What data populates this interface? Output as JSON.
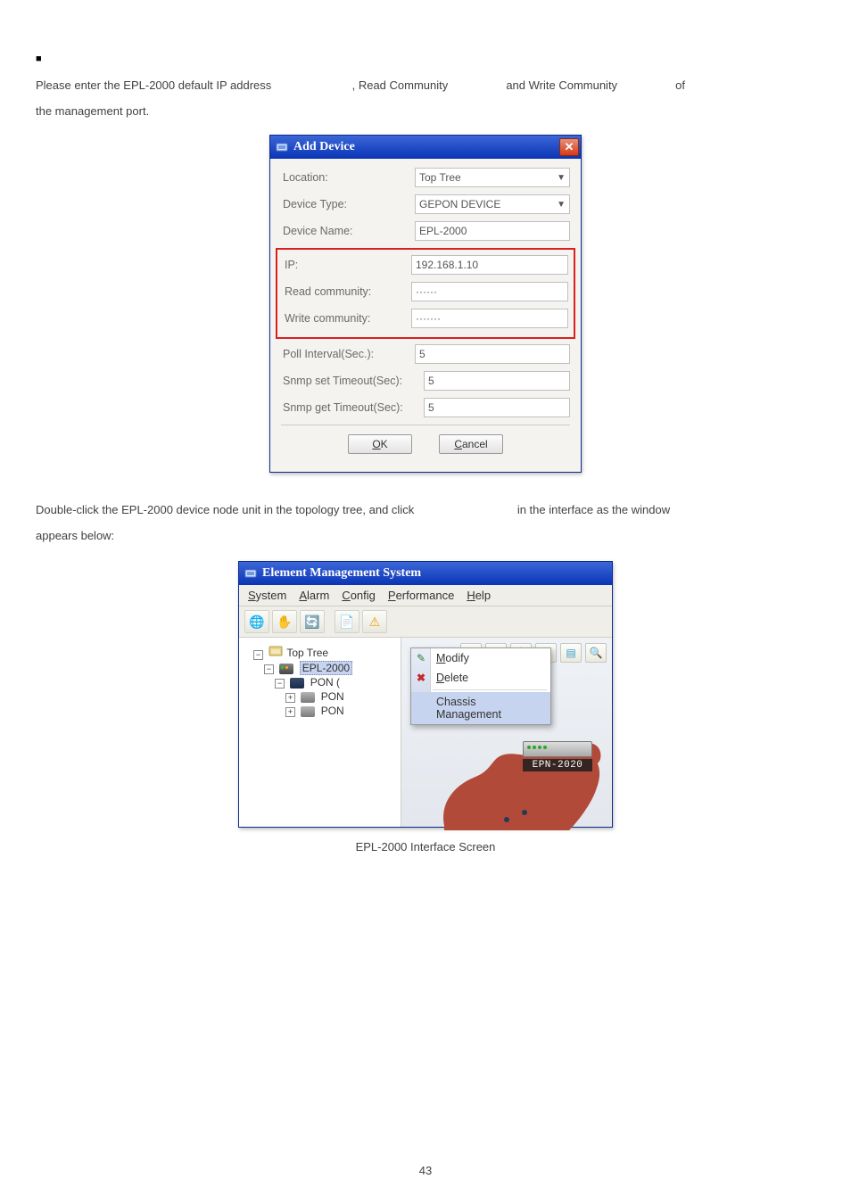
{
  "bullet": "■",
  "intro": {
    "p1a": "Please enter the EPL-2000 default IP address",
    "p1b": ", Read Community",
    "p1c": "and Write Community",
    "p1d": "of",
    "p2": "the management port."
  },
  "dialog": {
    "title": "Add Device",
    "rows": {
      "location_lbl": "Location:",
      "location_val": "Top Tree",
      "devtype_lbl": "Device Type:",
      "devtype_val": "GEPON DEVICE",
      "devname_lbl": "Device Name:",
      "devname_val": "EPL-2000",
      "ip_lbl": "IP:",
      "ip_val": "192.168.1.10",
      "rcomm_lbl": "Read community:",
      "rcomm_val": "······",
      "wcomm_lbl": "Write community:",
      "wcomm_val": "·······",
      "poll_lbl": "Poll Interval(Sec.):",
      "poll_val": "5",
      "snmpset_lbl": "Snmp set Timeout(Sec):",
      "snmpset_val": "5",
      "snmpget_lbl": "Snmp get Timeout(Sec):",
      "snmpget_val": "5"
    },
    "ok_u": "O",
    "ok_r": "K",
    "cancel_u": "C",
    "cancel_r": "ancel"
  },
  "mid": {
    "p1a": "Double-click the EPL-2000 device node unit in the topology tree, and click",
    "p1b": "in the interface as the window",
    "p2": "appears below:"
  },
  "ems": {
    "title": "Element Management System",
    "menu": {
      "system_u": "S",
      "system_r": "ystem",
      "alarm_u": "A",
      "alarm_r": "larm",
      "config_u": "C",
      "config_r": "onfig",
      "perf_u": "P",
      "perf_r": "erformance",
      "help_u": "H",
      "help_r": "elp"
    },
    "tree": {
      "root": "Top Tree",
      "epl": "EPL-2000",
      "pon_card": "PON (",
      "pon1": "PON",
      "pon2": "PON"
    },
    "ctx": {
      "modify_u": "M",
      "modify_r": "odify",
      "delete_u": "D",
      "delete_r": "elete",
      "chassis": "Chassis Management"
    },
    "devlabel": "EPN-2020"
  },
  "caption": "EPL-2000 Interface Screen",
  "pagenum": "43"
}
